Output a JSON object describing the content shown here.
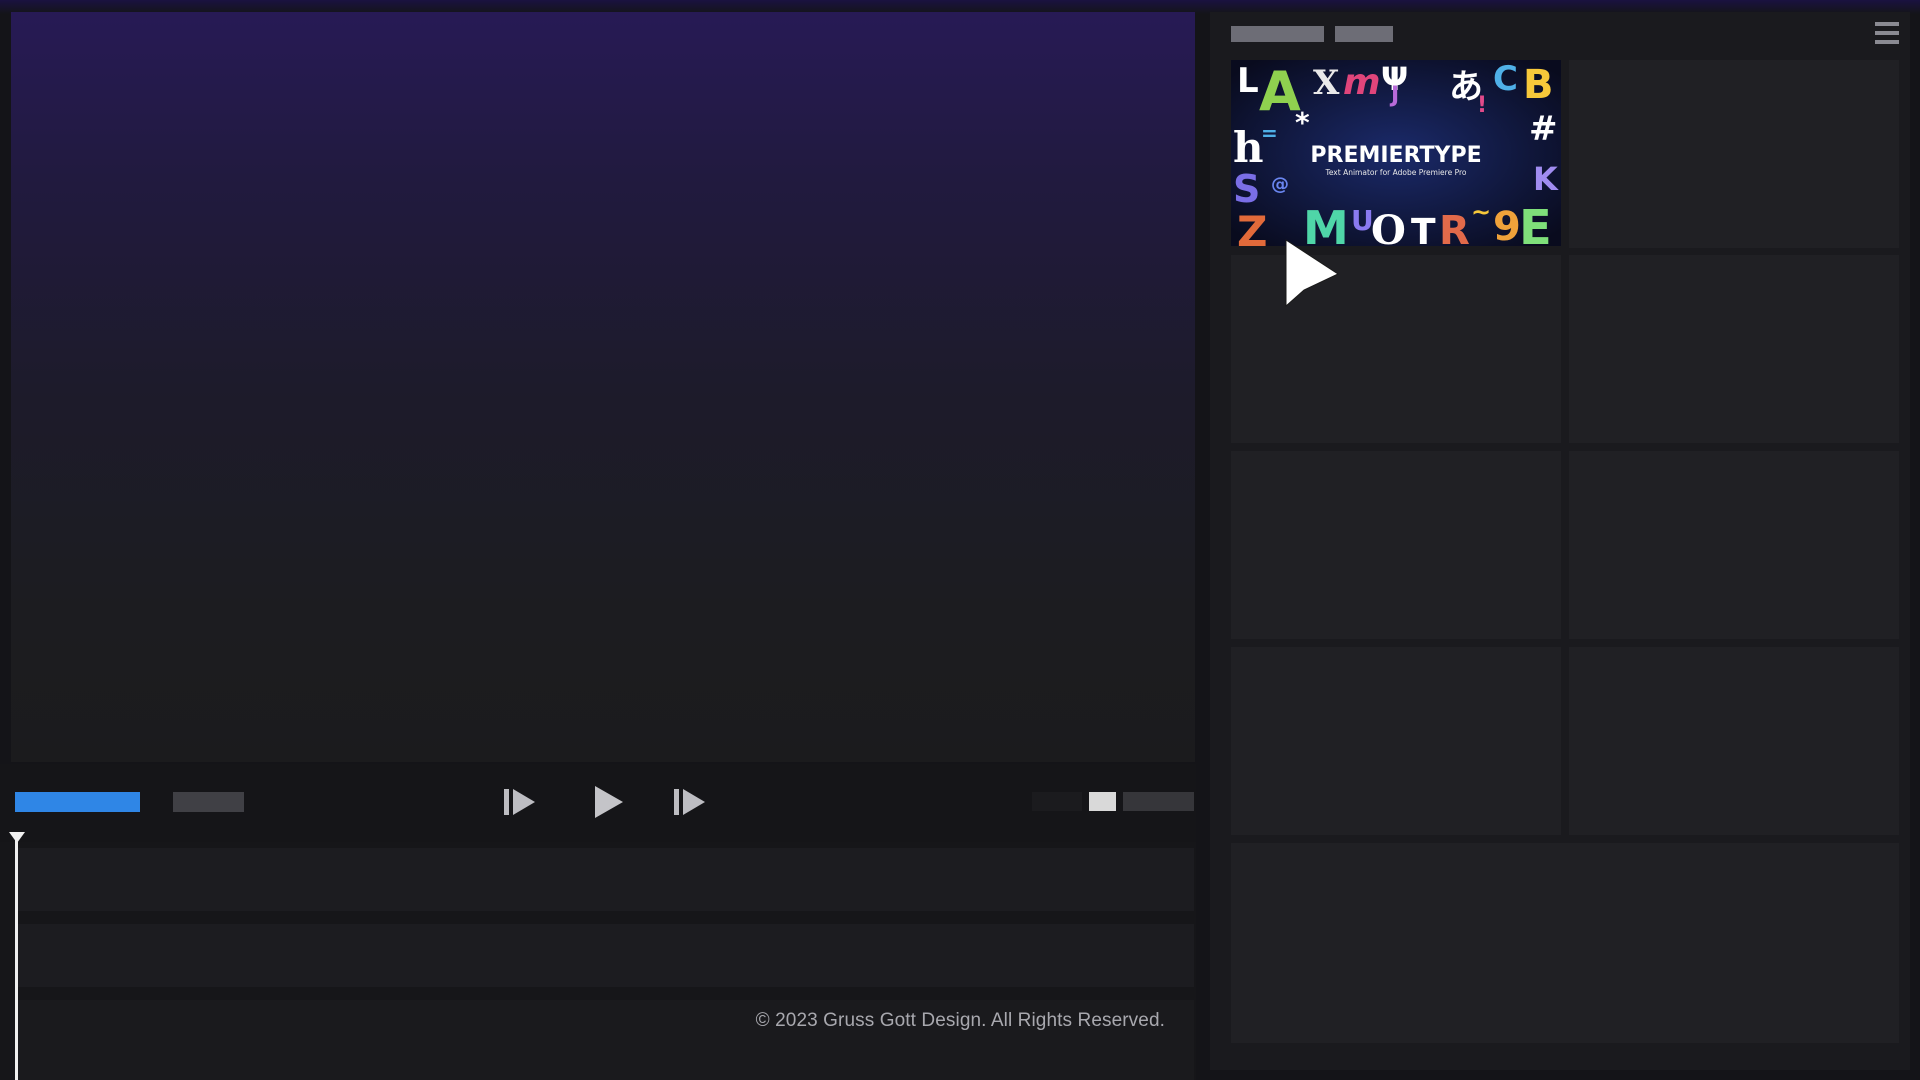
{
  "preview": {
    "background_top": "#271a55",
    "background_bottom": "#1b1b1d"
  },
  "transport": {
    "progress_color": "#2f86e6",
    "controls": [
      {
        "name": "step-back",
        "icon": "step-back-icon"
      },
      {
        "name": "play",
        "icon": "play-icon"
      },
      {
        "name": "step-forward",
        "icon": "step-forward-icon"
      }
    ]
  },
  "timeline": {
    "playhead_color": "#f0f0f0",
    "track_count": 3
  },
  "footer": {
    "copyright": "© 2023 Gruss Gott Design. All Rights Reserved."
  },
  "panel": {
    "menu_icon": "hamburger-menu-icon",
    "thumbnail": {
      "title": "PREMIERTYPE",
      "subtitle": "Text Animator for Adobe Premiere Pro",
      "letters": [
        "L",
        "A",
        "X",
        "m",
        "Ψ",
        "J",
        "あ",
        "C",
        "B",
        "h",
        "#",
        "S",
        "M",
        "R",
        "E",
        "K",
        "T",
        "O",
        "9",
        "*",
        "!",
        "@",
        "="
      ]
    }
  }
}
